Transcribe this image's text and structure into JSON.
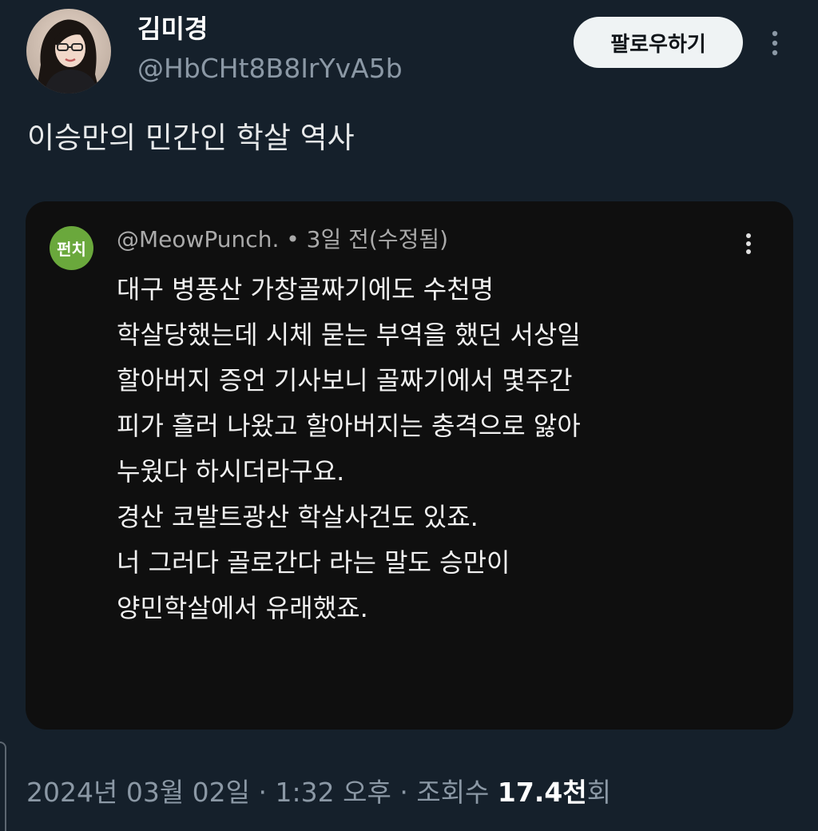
{
  "author": {
    "display_name": "김미경",
    "handle": "@HbCHt8B8IrYvA5b",
    "avatar_icon": "profile-photo"
  },
  "follow_button": {
    "label": "팔로우하기"
  },
  "more_icon": "vertical-ellipsis-icon",
  "tweet": {
    "text": "이승만의 민간인 학살 역사"
  },
  "quoted_comment": {
    "avatar_label": "펀치",
    "avatar_color": "#6aa83c",
    "username": "@MeowPunch.",
    "separator": " • ",
    "time": "3일 전(수정됨)",
    "lines": [
      "대구 병풍산 가창골짜기에도 수천명",
      "학살당했는데 시체 묻는 부역을 했던 서상일",
      "할아버지 증언 기사보니 골짜기에서 몇주간",
      "피가 흘러 나왔고 할아버지는 충격으로 앓아",
      "누웠다 하시더라구요.",
      "경산 코발트광산 학살사건도 있죠.",
      "너 그러다 골로간다 라는 말도 승만이",
      "양민학살에서 유래했죠."
    ]
  },
  "footer": {
    "date": "2024년 03월 02일",
    "time": "1:32 오후",
    "dot": " · ",
    "views_label": "조회수",
    "views_number": "17.4천",
    "views_suffix": "회"
  },
  "colors": {
    "background": "#15202b",
    "card_background": "#0f0f0f",
    "secondary_text": "#8b98a5",
    "follow_button_bg": "#eff3f4"
  }
}
